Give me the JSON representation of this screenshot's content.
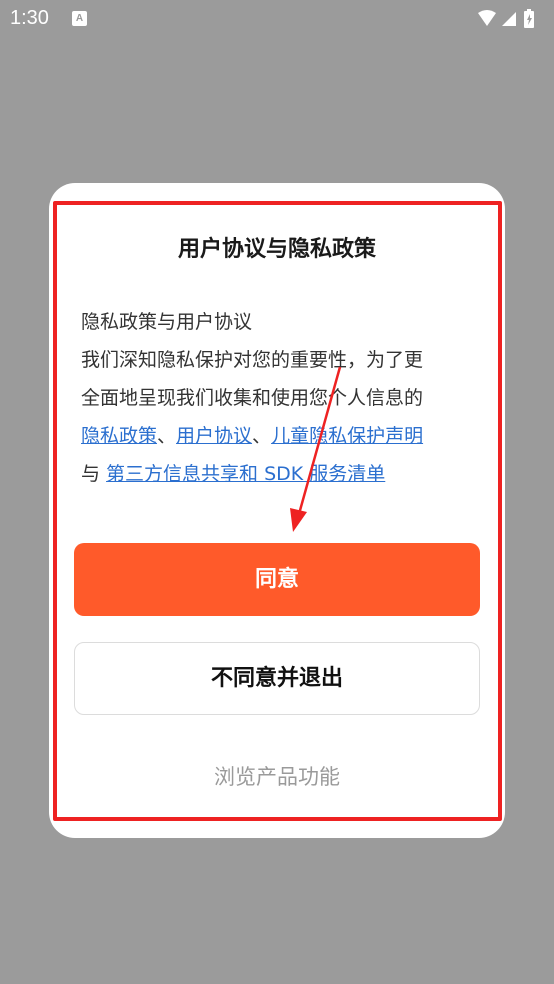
{
  "status_bar": {
    "time": "1:30",
    "notification_icon": "a-icon",
    "icons": [
      "wifi-icon",
      "signal-icon",
      "battery-icon"
    ]
  },
  "dialog": {
    "title": "用户协议与隐私政策",
    "body": {
      "line1": "隐私政策与用户协议",
      "line2": "我们深知隐私保护对您的重要性，为了更",
      "line3": "全面地呈现我们收集和使用您个人信息的",
      "link_privacy": "隐私政策",
      "sep1": "、",
      "link_user_agreement": "用户协议",
      "sep2": "、",
      "link_child_privacy": "儿童隐私保护声明",
      "conjunction": "与 ",
      "link_third_party": "第三方信息共享和 SDK 服务清单"
    },
    "agree_label": "同意",
    "disagree_label": "不同意并退出",
    "browse_label": "浏览产品功能"
  },
  "colors": {
    "overlay": "#9b9b9b",
    "accent": "#ff5a2a",
    "link": "#2b6fcf",
    "highlight": "#ee2222"
  }
}
